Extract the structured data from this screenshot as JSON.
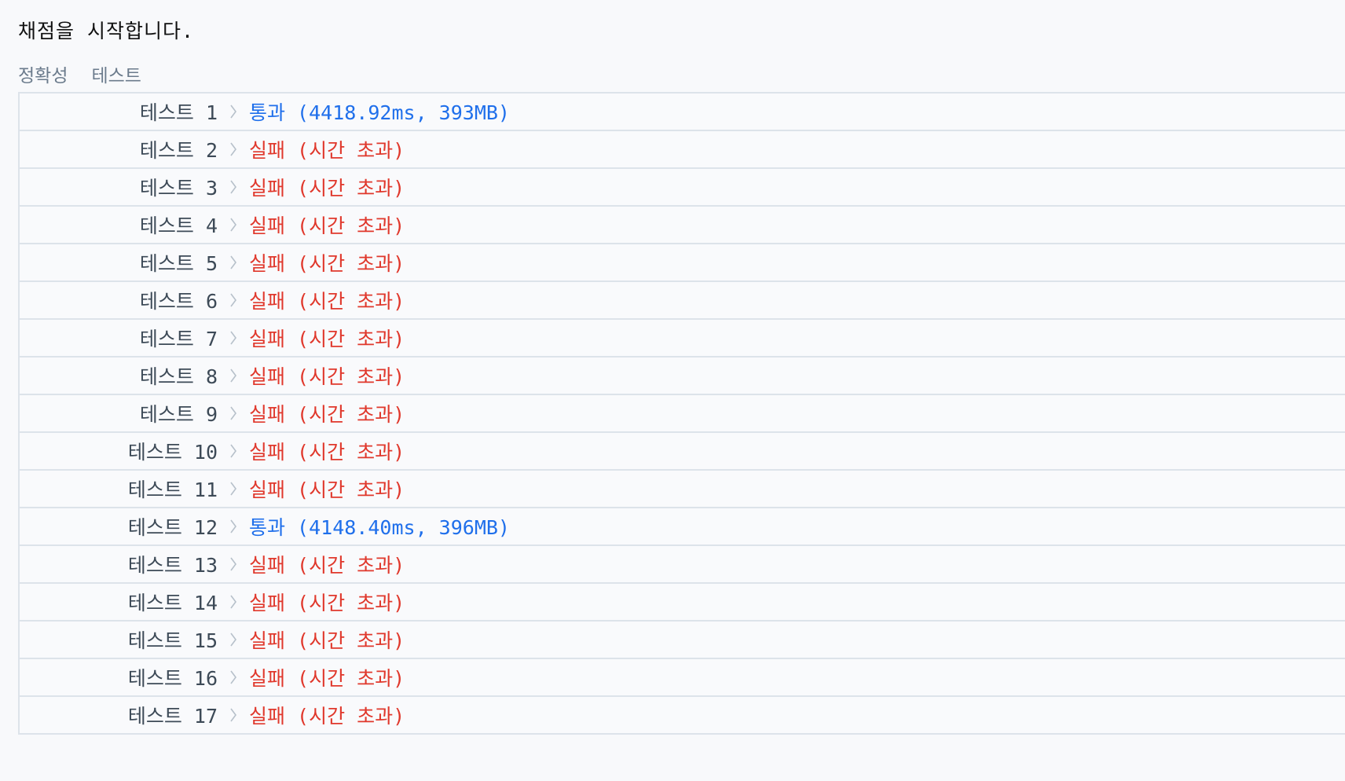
{
  "header": {
    "text": "채점을 시작합니다."
  },
  "section": {
    "category": "정확성",
    "type": "테스트"
  },
  "tests": [
    {
      "label": "테스트 1",
      "status": "pass",
      "result": "통과 (4418.92ms, 393MB)"
    },
    {
      "label": "테스트 2",
      "status": "fail",
      "result": "실패 (시간 초과)"
    },
    {
      "label": "테스트 3",
      "status": "fail",
      "result": "실패 (시간 초과)"
    },
    {
      "label": "테스트 4",
      "status": "fail",
      "result": "실패 (시간 초과)"
    },
    {
      "label": "테스트 5",
      "status": "fail",
      "result": "실패 (시간 초과)"
    },
    {
      "label": "테스트 6",
      "status": "fail",
      "result": "실패 (시간 초과)"
    },
    {
      "label": "테스트 7",
      "status": "fail",
      "result": "실패 (시간 초과)"
    },
    {
      "label": "테스트 8",
      "status": "fail",
      "result": "실패 (시간 초과)"
    },
    {
      "label": "테스트 9",
      "status": "fail",
      "result": "실패 (시간 초과)"
    },
    {
      "label": "테스트 10",
      "status": "fail",
      "result": "실패 (시간 초과)"
    },
    {
      "label": "테스트 11",
      "status": "fail",
      "result": "실패 (시간 초과)"
    },
    {
      "label": "테스트 12",
      "status": "pass",
      "result": "통과 (4148.40ms, 396MB)"
    },
    {
      "label": "테스트 13",
      "status": "fail",
      "result": "실패 (시간 초과)"
    },
    {
      "label": "테스트 14",
      "status": "fail",
      "result": "실패 (시간 초과)"
    },
    {
      "label": "테스트 15",
      "status": "fail",
      "result": "실패 (시간 초과)"
    },
    {
      "label": "테스트 16",
      "status": "fail",
      "result": "실패 (시간 초과)"
    },
    {
      "label": "테스트 17",
      "status": "fail",
      "result": "실패 (시간 초과)"
    }
  ],
  "colors": {
    "pass": "#1f6feb",
    "fail": "#e0382c"
  },
  "icons": {
    "row_separator": "chevron-right-icon"
  }
}
